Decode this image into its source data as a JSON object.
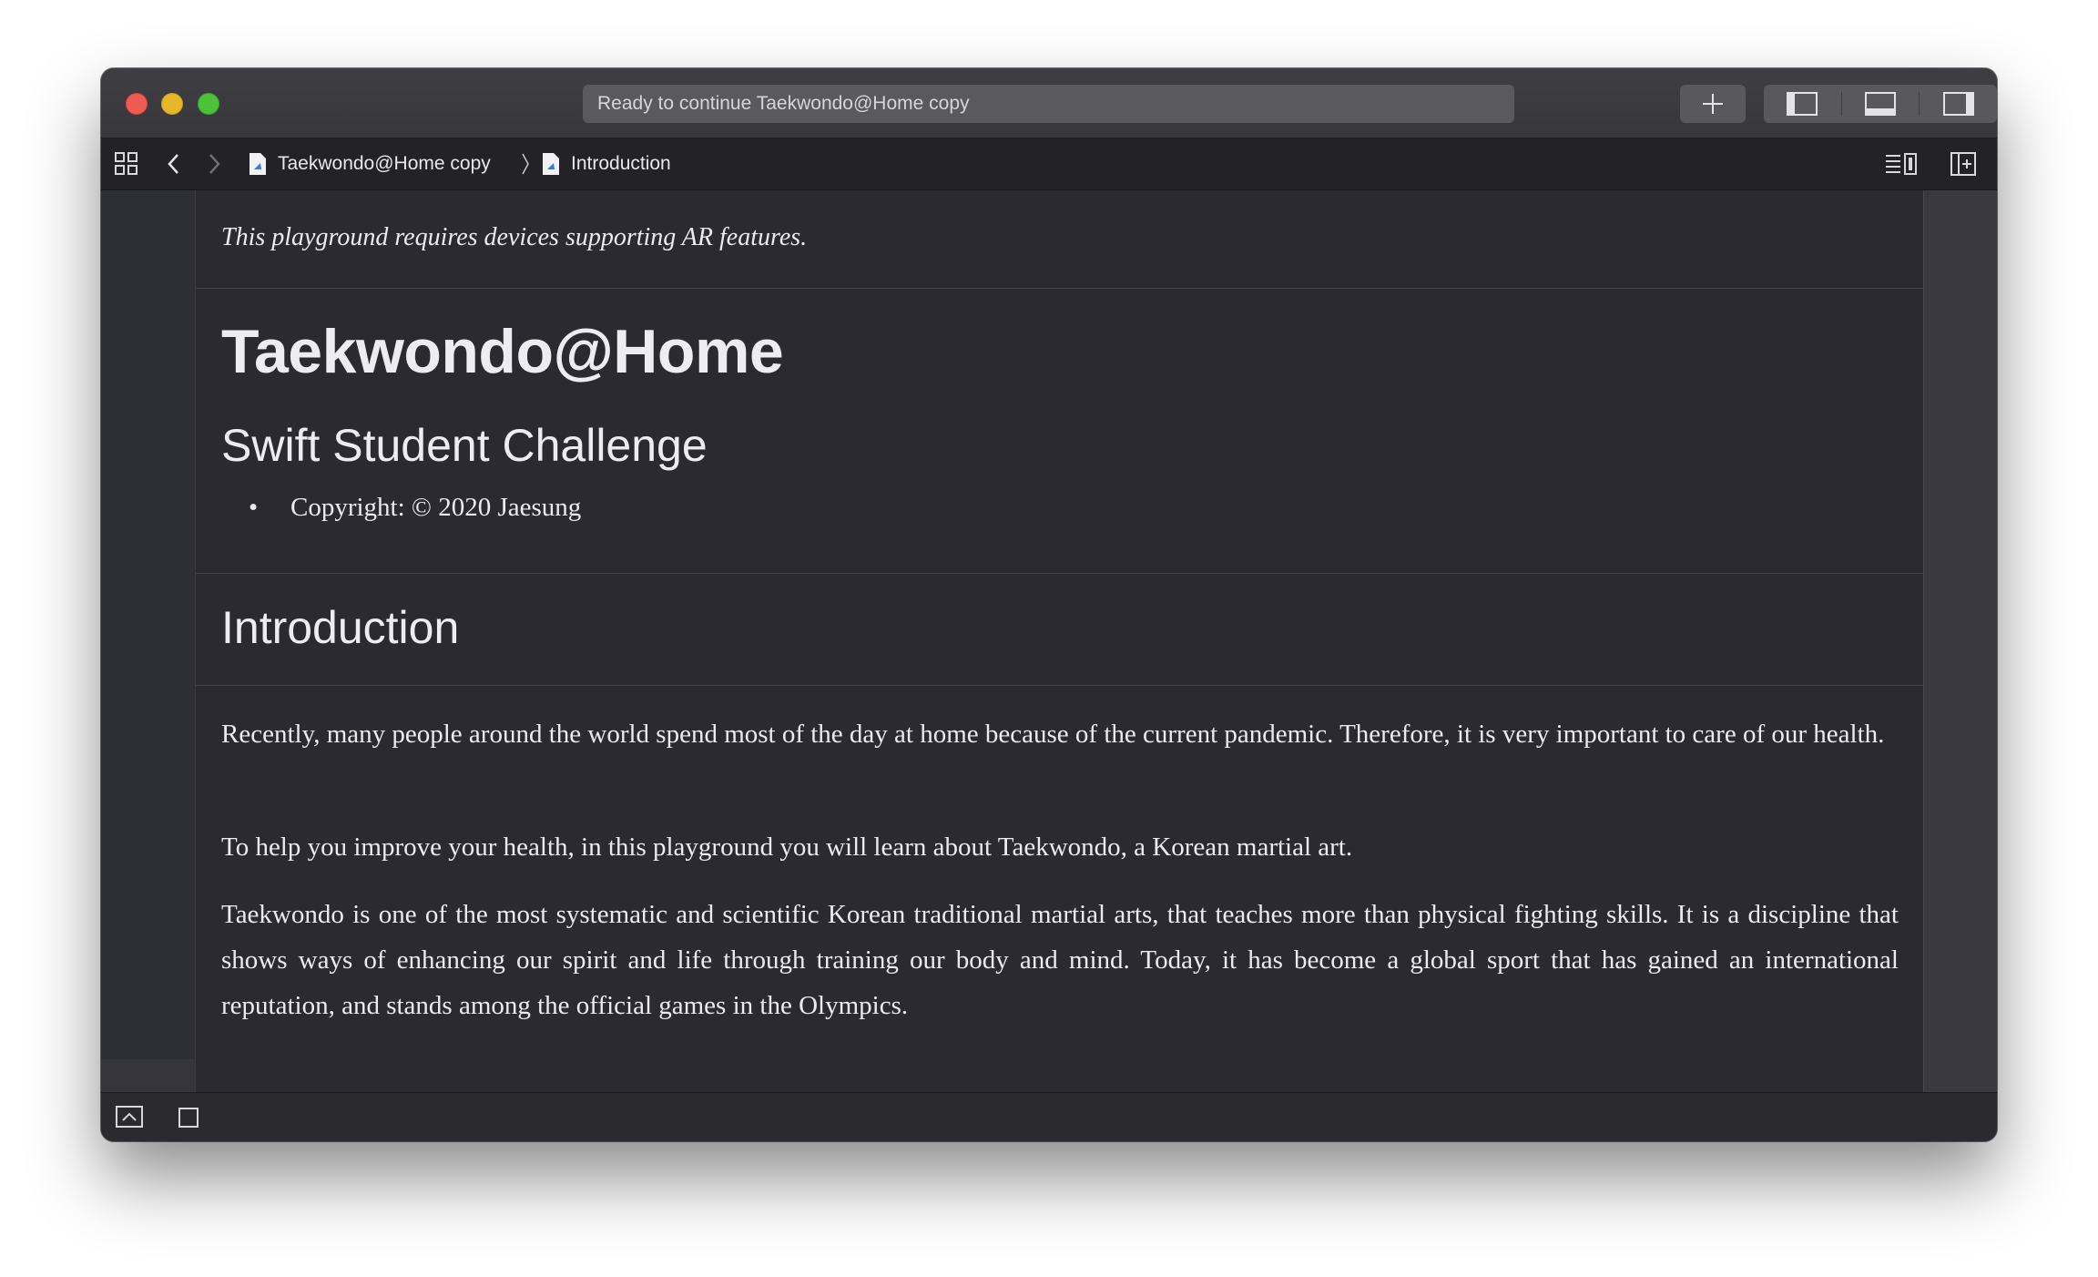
{
  "titlebar": {
    "status": "Ready to continue Taekwondo@Home copy",
    "add_icon": "plus-icon",
    "view_toggles": [
      "navigator-toggle-icon",
      "debug-area-toggle-icon",
      "inspector-toggle-icon"
    ]
  },
  "jumpbar": {
    "breadcrumbs": [
      "Taekwondo@Home copy",
      "Introduction"
    ]
  },
  "document": {
    "note": "This playground requires devices supporting AR features.",
    "title": "Taekwondo@Home",
    "subtitle": "Swift Student Challenge",
    "copyright": "Copyright: © 2020 Jaesung",
    "bullet": "•",
    "section_heading": "Introduction",
    "paragraphs": [
      "Recently, many people around the world spend most of the day at home because of the current pandemic.  Therefore, it is very important to care of our health.",
      "To help you improve your health, in this playground you will learn about Taekwondo, a Korean martial art.",
      "Taekwondo is one of the most systematic and scientific Korean traditional martial arts, that teaches more than physical fighting skills. It is a discipline that shows ways of enhancing our spirit and life through training our body and mind. Today, it has become a global sport that has gained an international reputation, and stands among the official games in the Olympics."
    ]
  },
  "colors": {
    "close": "#ee5b53",
    "minimize": "#e6b729",
    "zoom": "#4cc13a",
    "page_background": "#2b2a30"
  }
}
